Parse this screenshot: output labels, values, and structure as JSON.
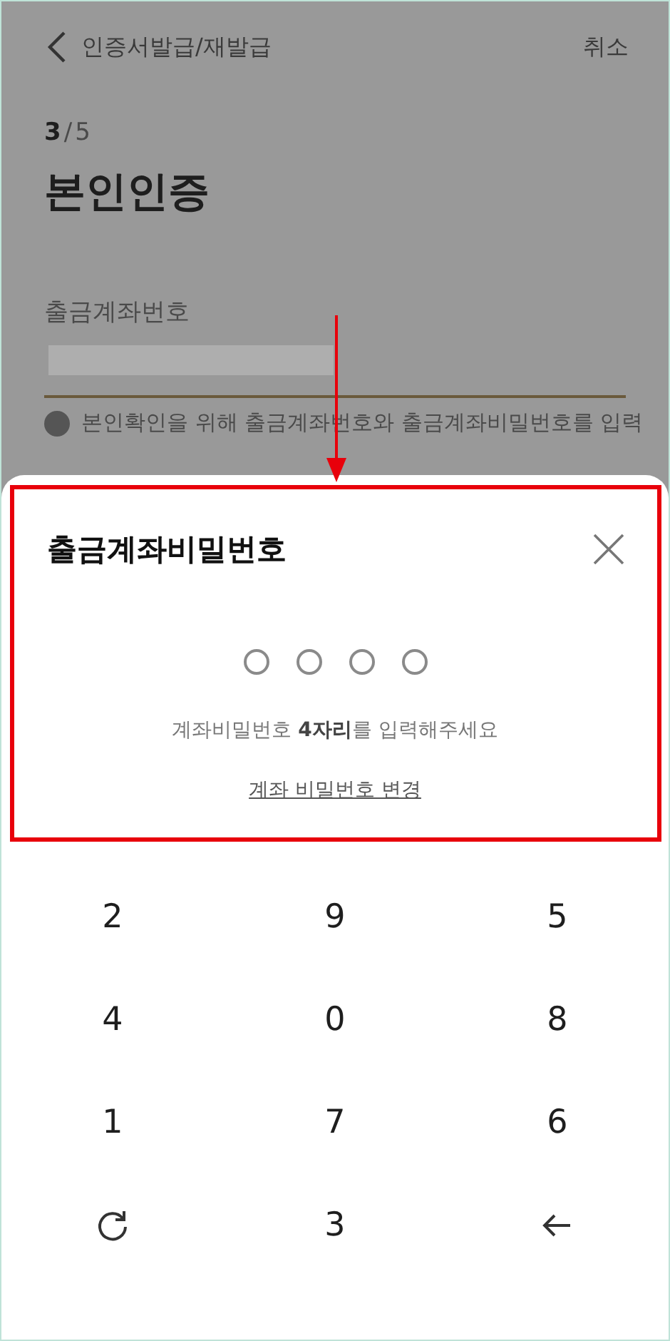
{
  "header": {
    "title": "인증서발급/재발급",
    "cancel": "취소"
  },
  "step": {
    "current": "3",
    "separator": "/",
    "total": "5"
  },
  "page_title": "본인인증",
  "account_field": {
    "label": "출금계좌번호"
  },
  "info_text": "본인확인을 위해 출금계좌번호와 출금계좌비밀번호를 입력",
  "sheet": {
    "title": "출금계좌비밀번호",
    "pin_dots": [
      {
        "filled": false
      },
      {
        "filled": false
      },
      {
        "filled": false
      },
      {
        "filled": false
      }
    ],
    "hint": "계좌비밀번호 **4자리**를 입력해주세요",
    "change_link": "계좌 비밀번호 변경"
  },
  "keypad": [
    {
      "kind": "digit",
      "label": "2"
    },
    {
      "kind": "digit",
      "label": "9"
    },
    {
      "kind": "digit",
      "label": "5"
    },
    {
      "kind": "digit",
      "label": "4"
    },
    {
      "kind": "digit",
      "label": "0"
    },
    {
      "kind": "digit",
      "label": "8"
    },
    {
      "kind": "digit",
      "label": "1"
    },
    {
      "kind": "digit",
      "label": "7"
    },
    {
      "kind": "digit",
      "label": "6"
    },
    {
      "kind": "reshuffle"
    },
    {
      "kind": "digit",
      "label": "3"
    },
    {
      "kind": "backspace"
    }
  ]
}
